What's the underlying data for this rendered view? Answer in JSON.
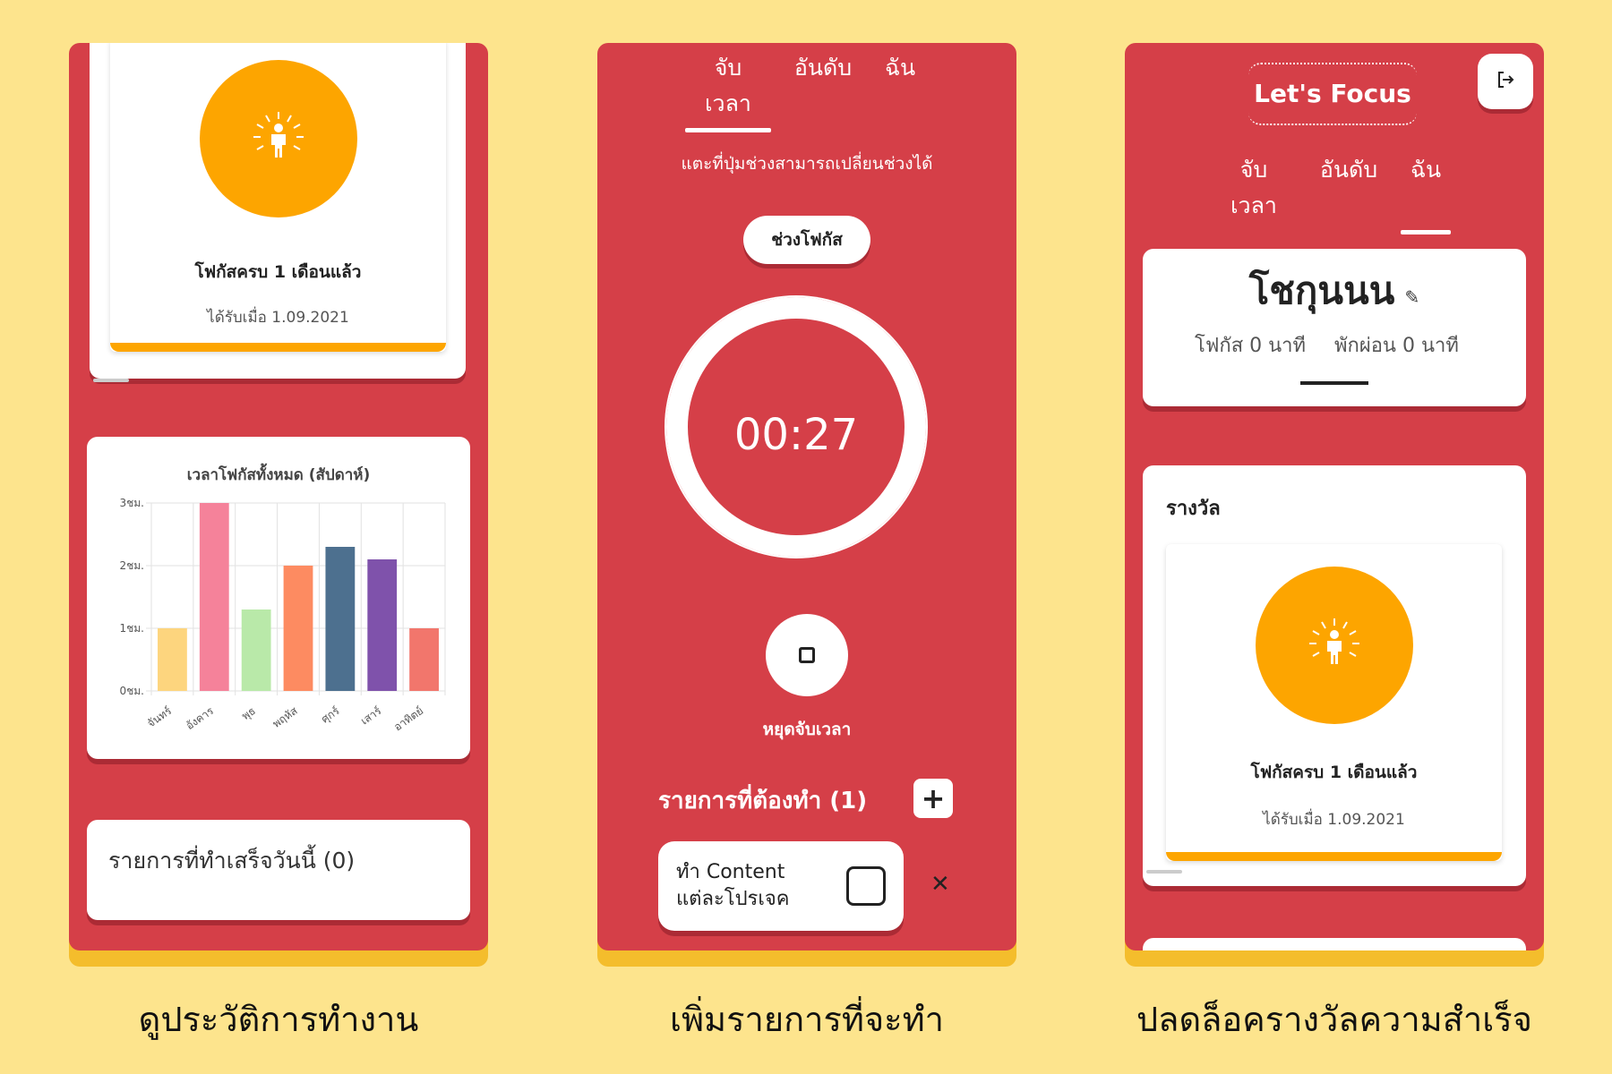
{
  "screens": {
    "history": {
      "award": {
        "title": "โฟกัสครบ 1 เดือนแล้ว",
        "date": "ได้รับเมื่อ 1.09.2021"
      },
      "todo_done": "รายการที่ทำเสร็จวันนี้ (0)",
      "caption": "ดูประวัติการทำงาน"
    },
    "timer": {
      "tabs": [
        "จับเวลา",
        "อันดับ",
        "ฉัน"
      ],
      "hint": "แตะที่ปุ่มช่วงสามารถเปลี่ยนช่วงได้",
      "mode_button": "ช่วงโฟกัส",
      "time": "00:27",
      "stop_label": "หยุดจับเวลา",
      "todo_header": "รายการที่ต้องทำ (1)",
      "todo_item": "ทำ Content\nแต่ละโปรเจค",
      "caption": "เพิ่มรายการที่จะทำ"
    },
    "profile": {
      "app_title": "Let's Focus",
      "tabs": [
        "จับเวลา",
        "อันดับ",
        "ฉัน"
      ],
      "user_name": "โชกุนนน",
      "focus_stat": "โฟกัส 0 นาที",
      "rest_stat": "พักผ่อน 0 นาที",
      "rewards_title": "รางวัล",
      "award": {
        "title": "โฟกัสครบ 1 เดือนแล้ว",
        "date": "ได้รับเมื่อ 1.09.2021"
      },
      "caption": "ปลดล็อครางวัลความสำเร็จ"
    }
  },
  "icons": {
    "medal": "person-glow-icon",
    "edit": "pencil-icon",
    "logout": "logout-icon",
    "add": "plus-icon",
    "stop": "stop-square-icon",
    "delete": "close-icon"
  },
  "colors": {
    "background": "#fde48d",
    "screen": "#d53f48",
    "accent": "#fda500",
    "shadow": "#f4bd2c"
  },
  "chart_data": {
    "type": "bar",
    "title": "เวลาโฟกัสทั้งหมด (สัปดาห์)",
    "categories": [
      "จันทร์",
      "อังคาร",
      "พุธ",
      "พฤหัส",
      "ศุกร์",
      "เสาร์",
      "อาทิตย์"
    ],
    "values": [
      1.0,
      3.0,
      1.3,
      2.0,
      2.3,
      2.1,
      1.0
    ],
    "colors": [
      "#fdd57e",
      "#f5829a",
      "#b9e9a9",
      "#fd8b61",
      "#4d708f",
      "#7f52ab",
      "#f2766c"
    ],
    "ylim": [
      0,
      3
    ],
    "yticks": [
      "0ชม.",
      "1ชม.",
      "2ชม.",
      "3ชม."
    ],
    "grid": true
  }
}
